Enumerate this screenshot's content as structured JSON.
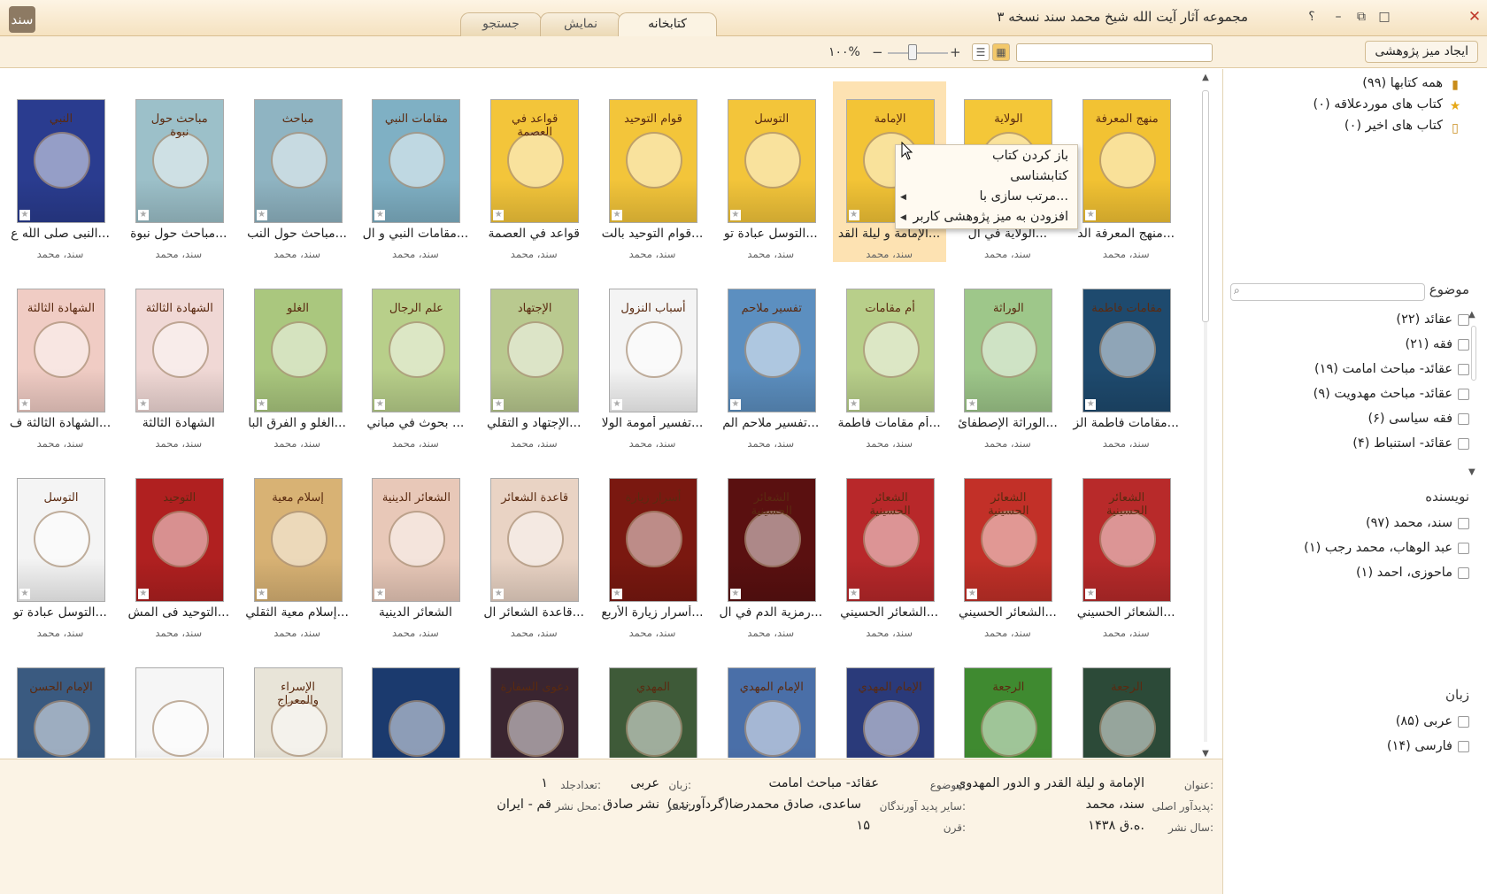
{
  "window": {
    "title": "مجموعه آثار آیت الله شیخ محمد سند نسخه ۳",
    "logo_text": "سند",
    "help_label": "؟",
    "controls": [
      "–",
      "□",
      "✕"
    ]
  },
  "tabs": [
    {
      "label": "کتابخانه",
      "active": true
    },
    {
      "label": "نمایش",
      "active": false
    },
    {
      "label": "جستجو",
      "active": false
    }
  ],
  "toolbar": {
    "new_workspace_label": "ایجاد میز پژوهشی",
    "search_placeholder": "",
    "zoom_value": "۱۰۰%",
    "zoom_out": "−",
    "zoom_in": "+"
  },
  "books": [
    {
      "title": "منهج المعرفة الد...",
      "author": "سند، محمد",
      "color": "#f2c233"
    },
    {
      "title": "الولاية في ال...",
      "author": "سند، محمد",
      "color": "#f4c738"
    },
    {
      "title": "الإمامة و ليلة القد...",
      "author": "سند، محمد",
      "color": "#f3c436",
      "selected": true
    },
    {
      "title": "التوسل عبادة تو...",
      "author": "سند، محمد",
      "color": "#f3c53a"
    },
    {
      "title": "قوام التوحيد بالت...",
      "author": "سند، محمد",
      "color": "#f3c53a"
    },
    {
      "title": "قواعد في العصمة",
      "author": "سند، محمد",
      "color": "#f3c53a"
    },
    {
      "title": "مقامات النبي و ال...",
      "author": "سند، محمد",
      "color": "#7fb0c4"
    },
    {
      "title": "مباحث حول النب...",
      "author": "سند، محمد",
      "color": "#8fb4c2"
    },
    {
      "title": "مباحث حول نبوة...",
      "author": "سند، محمد",
      "color": "#9cc0c9"
    },
    {
      "title": "النبی صلی اللّه ع...",
      "author": "سند، محمد",
      "color": "#2a3c8f"
    },
    {
      "title": "مقامات فاطمة الز...",
      "author": "سند، محمد",
      "color": "#1e4a6e"
    },
    {
      "title": "الوراثة الإصطفائ...",
      "author": "سند، محمد",
      "color": "#9ec78a"
    },
    {
      "title": "أم مقامات فاطمة...",
      "author": "سند، محمد",
      "color": "#b8cf8a"
    },
    {
      "title": "تفسير ملاحم الم...",
      "author": "سند، محمد",
      "color": "#5c8fc0"
    },
    {
      "title": "تفسير أمومة الولا...",
      "author": "سند، محمد",
      "color": "#f4f4f4"
    },
    {
      "title": "الإجتهاد و التقلي...",
      "author": "سند، محمد",
      "color": "#b9c98f"
    },
    {
      "title": "بحوث في مباني ...",
      "author": "سند، محمد",
      "color": "#b8cf8a"
    },
    {
      "title": "الغلو و الفرق البا...",
      "author": "سند، محمد",
      "color": "#aac77e"
    },
    {
      "title": "الشهادة الثالثة",
      "author": "سند، محمد",
      "color": "#f0d8d5"
    },
    {
      "title": "الشهادة الثالثة ف...",
      "author": "سند، محمد",
      "color": "#f0ccc4"
    },
    {
      "title": "الشعائر الحسيني...",
      "author": "سند، محمد",
      "color": "#b82a2a"
    },
    {
      "title": "الشعائر الحسيني...",
      "author": "سند، محمد",
      "color": "#c23028"
    },
    {
      "title": "الشعائر الحسيني...",
      "author": "سند، محمد",
      "color": "#b8282a"
    },
    {
      "title": "رمزية الدم في ال...",
      "author": "سند، محمد",
      "color": "#5a1010"
    },
    {
      "title": "أسرار زيارة الأربع...",
      "author": "سند، محمد",
      "color": "#7a1810"
    },
    {
      "title": "قاعدة الشعائر ال...",
      "author": "سند، محمد",
      "color": "#e9d3c4"
    },
    {
      "title": "الشعائر الدينية",
      "author": "سند، محمد",
      "color": "#e8c8b8"
    },
    {
      "title": "إسلام معية الثقلي...",
      "author": "سند، محمد",
      "color": "#d8b274"
    },
    {
      "title": "التوحيد فى المش...",
      "author": "سند، محمد",
      "color": "#b02020"
    },
    {
      "title": "التوسل عبادة تو...",
      "author": "سند، محمد",
      "color": "#f4f4f4"
    },
    {
      "title": "",
      "author": "",
      "color": "#2c4a38"
    },
    {
      "title": "",
      "author": "",
      "color": "#3f8a30"
    },
    {
      "title": "",
      "author": "",
      "color": "#2a3a7a"
    },
    {
      "title": "",
      "author": "",
      "color": "#4a6fa8"
    },
    {
      "title": "",
      "author": "",
      "color": "#3e5a38"
    },
    {
      "title": "",
      "author": "",
      "color": "#3a2530"
    },
    {
      "title": "",
      "author": "",
      "color": "#1b3a6e"
    },
    {
      "title": "",
      "author": "",
      "color": "#e8e4d8"
    },
    {
      "title": "",
      "author": "",
      "color": "#f6f6f6"
    },
    {
      "title": "",
      "author": "",
      "color": "#3a5a80"
    }
  ],
  "cover_texts": [
    "منهج المعرفة",
    "الولاية",
    "الإمامة",
    "التوسل",
    "قوام التوحيد",
    "قواعد في العصمة",
    "مقامات النبي",
    "مباحث",
    "مباحث حول نبوة",
    "النبي",
    "مقامات فاطمة",
    "الوراثة",
    "أم مقامات",
    "تفسير ملاحم",
    "أسباب النزول",
    "الإجتهاد",
    "علم الرجال",
    "الغلو",
    "الشهادة الثالثة",
    "الشهادة الثالثة",
    "الشعائر الحسينية",
    "الشعائر الحسينية",
    "الشعائر الحسينية",
    "الشعائر الحسينية",
    "أسرار زيارة",
    "قاعدة الشعائر",
    "الشعائر الدينية",
    "إسلام معية",
    "التوحيد",
    "التوسل",
    "الرجعة",
    "الرجعة",
    "الإمام المهدي",
    "الإمام المهدي",
    "المهدي",
    "دعوى السفارة",
    "",
    "الإسراء والمعراج",
    "",
    "الإمام الحسن"
  ],
  "context_menu": {
    "items": [
      {
        "label": "باز کردن کتاب",
        "submenu": false
      },
      {
        "label": "کتابشناسی",
        "submenu": false
      },
      {
        "label": "مرتب سازی با...",
        "submenu": true
      },
      {
        "label": "افزودن به میز پژوهشی کاربر",
        "submenu": true
      }
    ]
  },
  "sidebar": {
    "nav": [
      {
        "label": "همه کتابها (۹۹)",
        "icon": "books-icon"
      },
      {
        "label": "کتاب های موردعلاقه (۰)",
        "icon": "star-icon"
      },
      {
        "label": "کتاب های اخیر (۰)",
        "icon": "recent-book-icon"
      }
    ],
    "subject_title": "موضوع",
    "subjects": [
      {
        "label": "عقائد (۲۲)"
      },
      {
        "label": "فقه (۲۱)"
      },
      {
        "label": "عقائد- مباحث امامت (۱۹)"
      },
      {
        "label": "عقائد- مباحث مهدویت (۹)"
      },
      {
        "label": "فقه سیاسی (۶)"
      },
      {
        "label": "عقائد- استنباط (۴)"
      }
    ],
    "author_title": "نویسنده",
    "authors": [
      {
        "label": "سند، محمد (۹۷)"
      },
      {
        "label": "عبد الوهاب، محمد رجب (۱)"
      },
      {
        "label": "ماحوزی، احمد (۱)"
      }
    ],
    "language_title": "زبان",
    "languages": [
      {
        "label": "عربی (۸۵)"
      },
      {
        "label": "فارسی (۱۴)"
      }
    ]
  },
  "details": {
    "title_label": "عنوان:",
    "title_value": "الإمامة و ليلة القدر و الدور المهدوي",
    "subject_label": "موضوع:",
    "subject_value": "عقائد- مباحث امامت",
    "language_label": "زبان:",
    "language_value": "عربی",
    "volumes_label": "تعدادجلد:",
    "volumes_value": "۱",
    "author_label": "پدیدآور اصلی:",
    "author_value": "سند، محمد",
    "others_label": "سایر پدید آورندگان:",
    "others_value": "ساعدی، صادق محمدرضا(گردآورنده)",
    "publisher_label": "ناشر:",
    "publisher_value": "نشر صادق",
    "place_label": "محل نشر:",
    "place_value": "قم - ایران",
    "year_label": "سال نشر:",
    "year_value": "۱۴۳۸ ه.ق.",
    "century_label": "قرن:",
    "century_value": "۱۵"
  },
  "colors": {
    "accent": "#f3c86a",
    "selection": "#fde2b2",
    "chrome": "#faf0de"
  }
}
